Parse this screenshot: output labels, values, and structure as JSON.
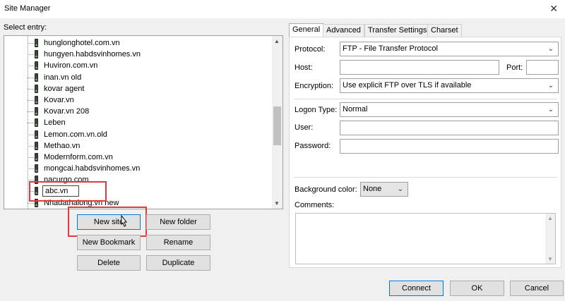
{
  "window": {
    "title": "Site Manager",
    "close_glyph": "✕"
  },
  "left": {
    "select_label": "Select entry:",
    "entries": [
      "hunglonghotel.com.vn",
      "hungyen.habdsvinhomes.vn",
      "Huviron.com.vn",
      "inan.vn old",
      "kovar agent",
      "Kovar.vn",
      "Kovar.vn 208",
      "Leben",
      "Lemon.com.vn.old",
      "Methao.vn",
      "Modernform.com.vn",
      "mongcai.habdsvinhomes.vn",
      "nacurgo.com"
    ],
    "editing_value": "abc.vn",
    "partial_entry": "Nhadathalong.vn new",
    "buttons": {
      "new_site": "New site",
      "new_folder": "New folder",
      "new_bookmark": "New Bookmark",
      "rename": "Rename",
      "delete": "Delete",
      "duplicate": "Duplicate"
    }
  },
  "tabs": [
    "General",
    "Advanced",
    "Transfer Settings",
    "Charset"
  ],
  "general": {
    "protocol_label": "Protocol:",
    "protocol_value": "FTP - File Transfer Protocol",
    "host_label": "Host:",
    "port_label": "Port:",
    "encryption_label": "Encryption:",
    "encryption_value": "Use explicit FTP over TLS if available",
    "logon_type_label": "Logon Type:",
    "logon_type_value": "Normal",
    "user_label": "User:",
    "password_label": "Password:",
    "background_color_label": "Background color:",
    "background_color_value": "None",
    "comments_label": "Comments:"
  },
  "footer": {
    "connect": "Connect",
    "ok": "OK",
    "cancel": "Cancel"
  },
  "icons": {
    "combo_arrow": "⌄",
    "scroll_up": "▲",
    "scroll_down": "▼"
  },
  "colors": {
    "highlight_box": "#e0393e",
    "focus_border": "#0078d7"
  }
}
